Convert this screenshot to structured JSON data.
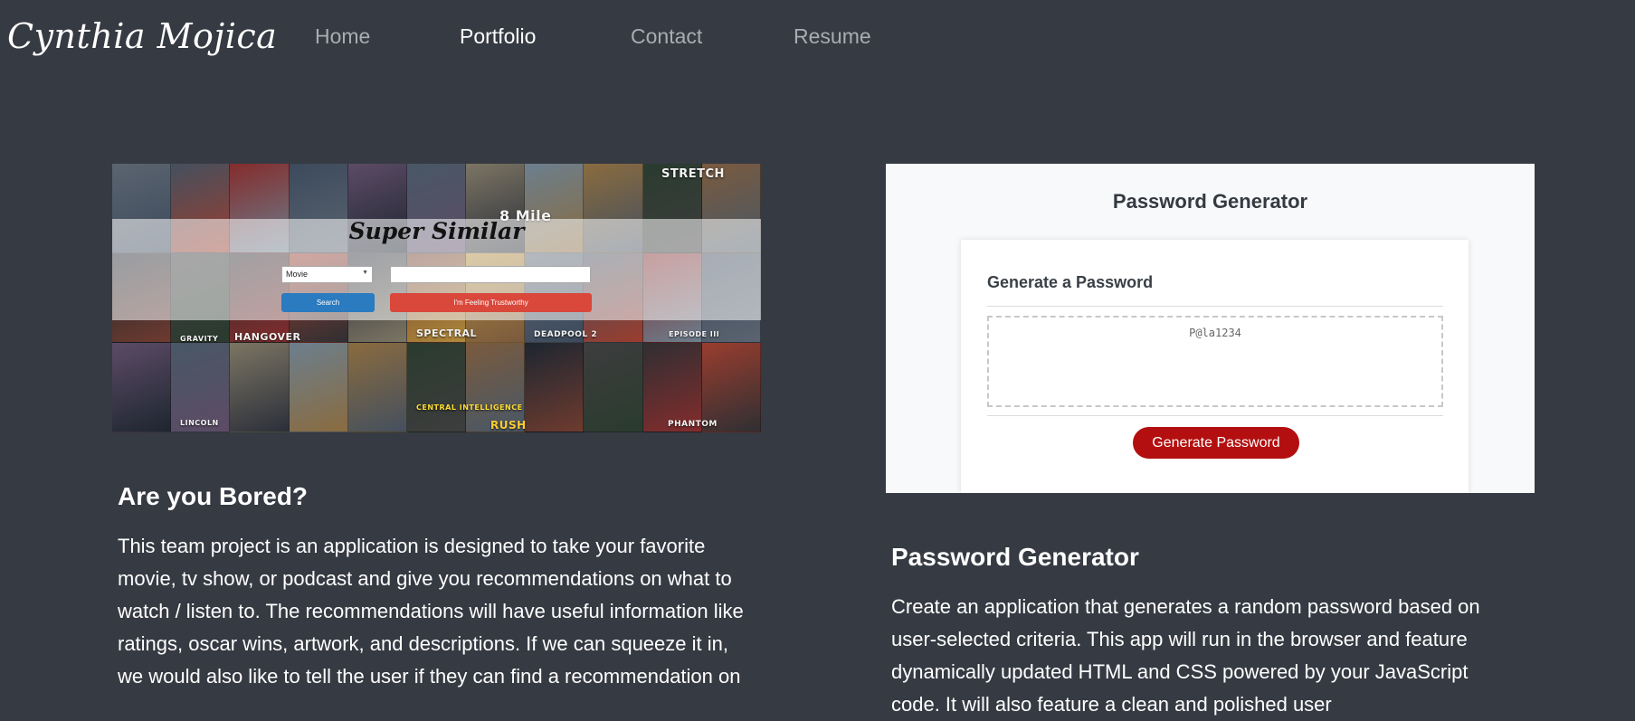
{
  "nav": {
    "brand": "Cynthia Mojica",
    "links": [
      {
        "label": "Home",
        "active": false
      },
      {
        "label": "Portfolio",
        "active": true
      },
      {
        "label": "Contact",
        "active": false
      },
      {
        "label": "Resume",
        "active": false
      }
    ]
  },
  "colors": {
    "page_bg": "#363a42",
    "nav_inactive": "#a9acb1",
    "text": "#ffffff",
    "search_button": "#2a7bc0",
    "lucky_button": "#d9483b",
    "generate_button": "#b30f10"
  },
  "projects": [
    {
      "title": "Are you Bored?",
      "description": "This team project is an application is designed to take your favorite movie, tv show, or podcast and give you recommendations on what to watch / listen to. The recommendations will have useful information like ratings, oscar wins, artwork, and descriptions. If we can squeeze it in, we would also like to tell the user if they can find a recommendation on",
      "screenshot": {
        "app_title": "Super Similar",
        "select_value": "Movie",
        "search_label": "Search",
        "lucky_label": "I'm Feeling Trustworthy",
        "poster_texts": [
          "8 Mile",
          "SPECTRAL",
          "HANGOVER",
          "GRAVITY",
          "STRETCH",
          "DEADPOOL 2",
          "EPISODE III",
          "PHANTOM",
          "LINCOLN",
          "RUSH",
          "CENTRAL INTELLIGENCE"
        ]
      }
    },
    {
      "title": "Password Generator",
      "description": "Create an application that generates a random password based on user-selected criteria. This app will run in the browser and feature dynamically updated HTML and CSS powered by your JavaScript code. It will also feature a clean and polished user",
      "screenshot": {
        "app_title": "Password Generator",
        "card_heading": "Generate a Password",
        "password_value": "P@la1234",
        "button_label": "Generate Password"
      }
    }
  ]
}
